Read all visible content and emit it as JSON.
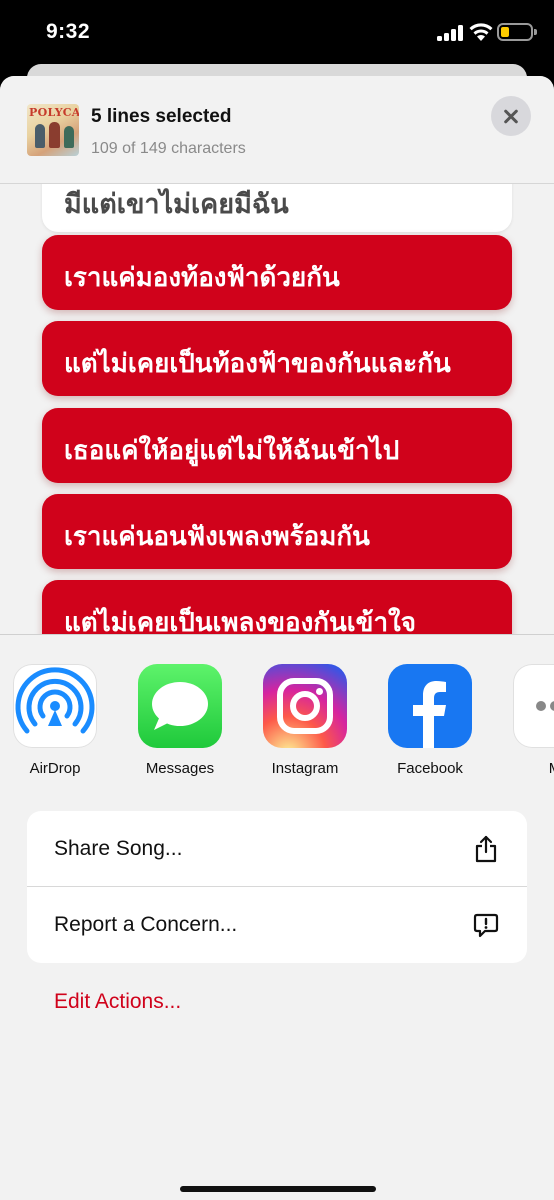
{
  "status_bar": {
    "time": "9:32"
  },
  "header": {
    "album_art_text": "POLYCAT",
    "title": "5 lines selected",
    "subtitle": "109 of 149 characters"
  },
  "lyrics": {
    "partial_line": "มีแต่เขาไม่เคยมีฉัน",
    "selected_lines": [
      "เราแค่มองท้องฟ้าด้วยกัน",
      "แต่ไม่เคยเป็นท้องฟ้าของกันและกัน",
      "เธอแค่ให้อยู่แต่ไม่ให้ฉันเข้าไป",
      "เราแค่นอนฟังเพลงพร้อมกัน",
      "แต่ไม่เคยเป็นเพลงของกันเข้าใจ"
    ],
    "selected_color": "#d0021b"
  },
  "share": {
    "apps": [
      {
        "label": "AirDrop",
        "icon": "airdrop-icon"
      },
      {
        "label": "Messages",
        "icon": "messages-icon"
      },
      {
        "label": "Instagram",
        "icon": "instagram-icon"
      },
      {
        "label": "Facebook",
        "icon": "facebook-icon"
      },
      {
        "label": "M",
        "icon": "more-icon"
      }
    ],
    "actions": [
      {
        "label": "Share Song...",
        "icon": "share-icon"
      },
      {
        "label": "Report a Concern...",
        "icon": "report-icon"
      }
    ],
    "edit_actions": "Edit Actions...",
    "accent_color": "#d0021b"
  }
}
